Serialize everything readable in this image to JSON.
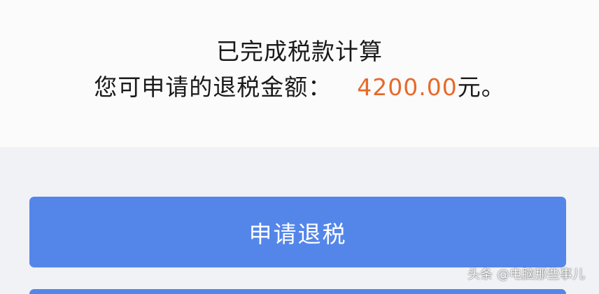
{
  "result": {
    "title": "已完成税款计算",
    "refund_label": "您可申请的退税金额：",
    "refund_amount": "4200.00",
    "refund_unit": "元。"
  },
  "actions": {
    "apply_refund_label": "申请退税"
  },
  "watermark": {
    "text": "头条 @电脑那些事儿"
  },
  "colors": {
    "amount": "#e8692a",
    "button": "#5486ea",
    "panel_bg": "#f1f2f6"
  }
}
